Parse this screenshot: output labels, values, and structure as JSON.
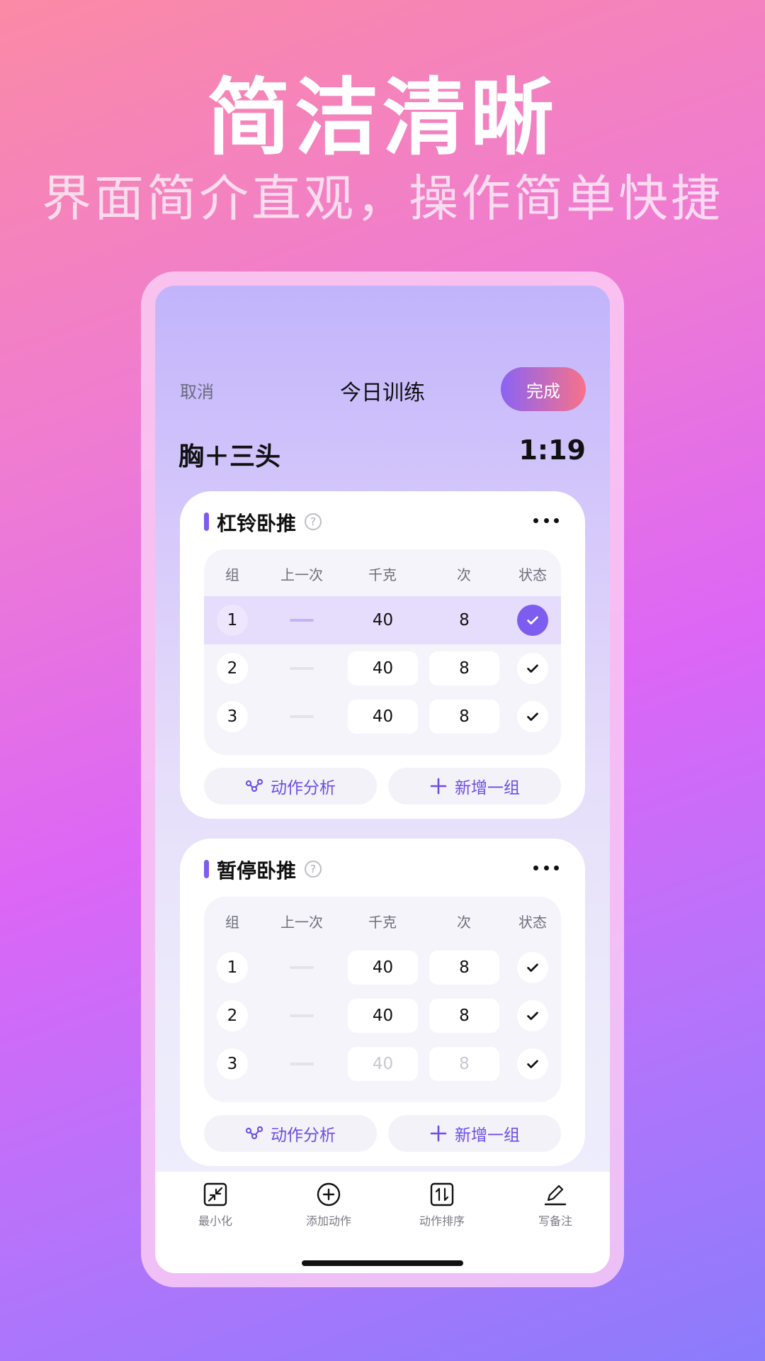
{
  "promo": {
    "headline": "简洁清晰",
    "subline": "界面简介直观，操作简单快捷"
  },
  "nav": {
    "cancel": "取消",
    "title": "今日训练",
    "done": "完成"
  },
  "session": {
    "name": "胸＋三头",
    "timer": "1:19"
  },
  "table_headers": [
    "组",
    "上一次",
    "千克",
    "次",
    "状态"
  ],
  "exercises": [
    {
      "title": "杠铃卧推",
      "help": "?",
      "sets": [
        {
          "set": "1",
          "kg": "40",
          "reps": "8",
          "completed": true
        },
        {
          "set": "2",
          "kg": "40",
          "reps": "8",
          "completed": false
        },
        {
          "set": "3",
          "kg": "40",
          "reps": "8",
          "completed": false
        }
      ],
      "analyze_label": "动作分析",
      "add_set_label": "新增一组"
    },
    {
      "title": "暂停卧推",
      "help": "?",
      "sets": [
        {
          "set": "1",
          "kg": "40",
          "reps": "8",
          "completed": false
        },
        {
          "set": "2",
          "kg": "40",
          "reps": "8",
          "completed": false
        },
        {
          "set": "3",
          "kg": "40",
          "reps": "8",
          "completed": false,
          "placeholder": true
        }
      ],
      "analyze_label": "动作分析",
      "add_set_label": "新增一组"
    }
  ],
  "bottom_tabs": [
    {
      "label": "最小化",
      "icon": "minimize-icon"
    },
    {
      "label": "添加动作",
      "icon": "add-circle-icon"
    },
    {
      "label": "动作排序",
      "icon": "sort-icon"
    },
    {
      "label": "写备注",
      "icon": "pencil-icon"
    }
  ],
  "colors": {
    "accent": "#7d5cf0",
    "done_gradient_start": "#8a63f4",
    "done_gradient_end": "#f7728a",
    "active_row": "#e6dcfb"
  }
}
